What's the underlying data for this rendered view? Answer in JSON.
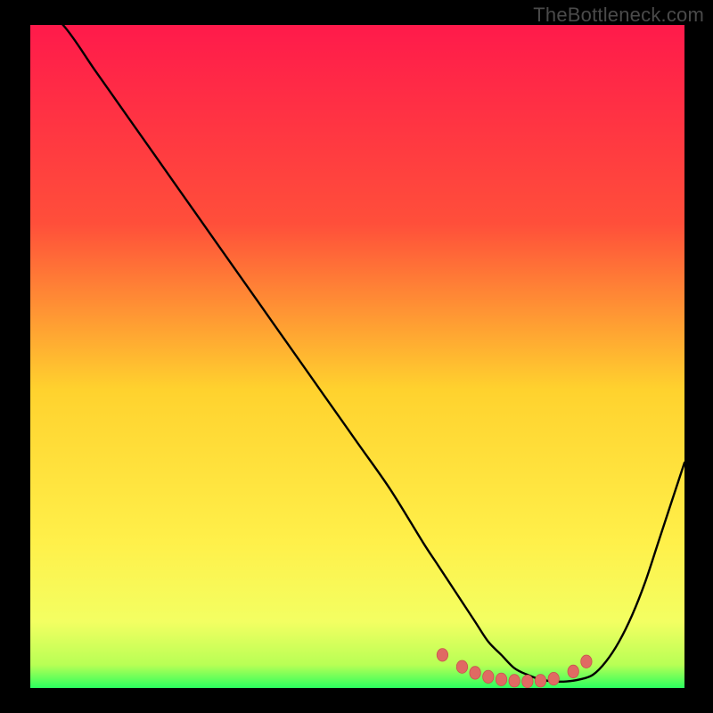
{
  "attribution": "TheBottleneck.com",
  "colors": {
    "bg_black": "#000000",
    "gradient_top": "#ff1a4b",
    "gradient_mid1": "#ff6a2f",
    "gradient_mid2": "#ffd22e",
    "gradient_mid3": "#fff66a",
    "gradient_bottom": "#2bff5e",
    "curve": "#000000",
    "marker_fill": "#e06a63",
    "marker_stroke": "#c9534d"
  },
  "chart_data": {
    "type": "line",
    "title": "",
    "xlabel": "",
    "ylabel": "",
    "xlim": [
      0,
      100
    ],
    "ylim": [
      0,
      100
    ],
    "grid": false,
    "legend": false,
    "curve": {
      "name": "bottleneck-curve",
      "x": [
        0,
        5,
        10,
        15,
        20,
        25,
        30,
        35,
        40,
        45,
        50,
        55,
        60,
        62,
        64,
        66,
        68,
        70,
        72,
        74,
        76,
        78,
        80,
        82,
        84,
        86,
        88,
        90,
        92,
        94,
        96,
        98,
        100
      ],
      "y": [
        104,
        100,
        93,
        86,
        79,
        72,
        65,
        58,
        51,
        44,
        37,
        30,
        22,
        19,
        16,
        13,
        10,
        7,
        5,
        3,
        2,
        1.3,
        1,
        1,
        1.3,
        2,
        4,
        7,
        11,
        16,
        22,
        28,
        34
      ]
    },
    "markers": {
      "name": "highlight-dots",
      "points": [
        {
          "x": 63,
          "y": 5.0
        },
        {
          "x": 66,
          "y": 3.2
        },
        {
          "x": 68,
          "y": 2.3
        },
        {
          "x": 70,
          "y": 1.7
        },
        {
          "x": 72,
          "y": 1.3
        },
        {
          "x": 74,
          "y": 1.1
        },
        {
          "x": 76,
          "y": 1.0
        },
        {
          "x": 78,
          "y": 1.1
        },
        {
          "x": 80,
          "y": 1.4
        },
        {
          "x": 83,
          "y": 2.5
        },
        {
          "x": 85,
          "y": 4.0
        }
      ]
    }
  }
}
